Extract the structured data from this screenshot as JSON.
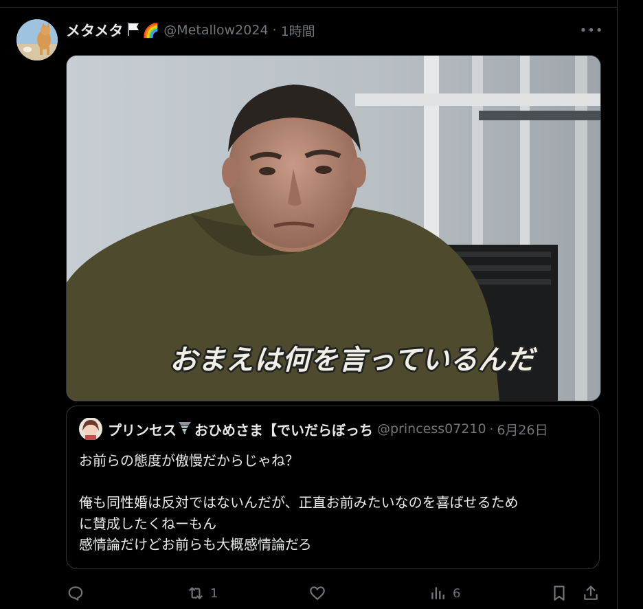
{
  "post": {
    "display_name": "メタメタ",
    "name_emoji": "🌈",
    "handle": "@Metallow2024",
    "separator": "·",
    "time": "1時間",
    "more_label": "•••"
  },
  "media": {
    "caption": "おまえは何を言っているんだ"
  },
  "quote": {
    "display_name": "プリンセス",
    "name_suffix": "おひめさま【でいだらぼっち",
    "handle": "@princess07210",
    "separator": "·",
    "date": "6月26日",
    "lines": [
      "お前らの態度が傲慢だからじゃね？",
      "",
      "俺も同性婚は反対ではないんだが、正直お前みたいなのを喜ばせるため",
      "に賛成したくねーもん",
      "感情論だけどお前らも大概感情論だろ"
    ]
  },
  "actions": {
    "reply_count": "",
    "repost_count": "1",
    "like_count": "",
    "views_count": "6"
  },
  "colors": {
    "background": "#000000",
    "text": "#e7e9ea",
    "secondary_text": "#71767b",
    "border": "#2f3336"
  }
}
